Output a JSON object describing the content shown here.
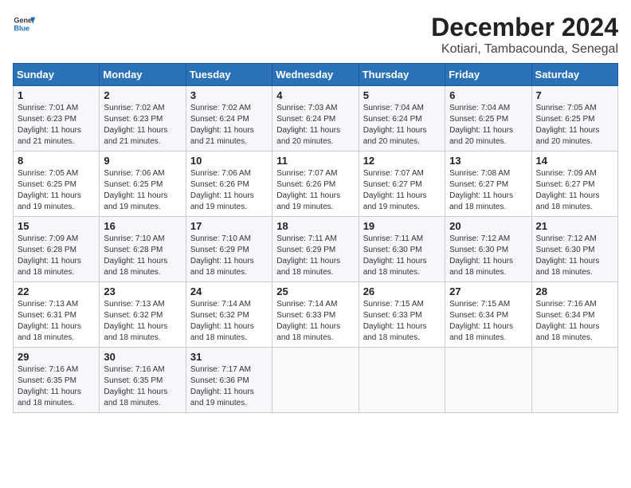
{
  "header": {
    "logo_line1": "General",
    "logo_line2": "Blue",
    "title": "December 2024",
    "subtitle": "Kotiari, Tambacounda, Senegal"
  },
  "weekdays": [
    "Sunday",
    "Monday",
    "Tuesday",
    "Wednesday",
    "Thursday",
    "Friday",
    "Saturday"
  ],
  "weeks": [
    [
      {
        "day": "1",
        "info": "Sunrise: 7:01 AM\nSunset: 6:23 PM\nDaylight: 11 hours\nand 21 minutes."
      },
      {
        "day": "2",
        "info": "Sunrise: 7:02 AM\nSunset: 6:23 PM\nDaylight: 11 hours\nand 21 minutes."
      },
      {
        "day": "3",
        "info": "Sunrise: 7:02 AM\nSunset: 6:24 PM\nDaylight: 11 hours\nand 21 minutes."
      },
      {
        "day": "4",
        "info": "Sunrise: 7:03 AM\nSunset: 6:24 PM\nDaylight: 11 hours\nand 20 minutes."
      },
      {
        "day": "5",
        "info": "Sunrise: 7:04 AM\nSunset: 6:24 PM\nDaylight: 11 hours\nand 20 minutes."
      },
      {
        "day": "6",
        "info": "Sunrise: 7:04 AM\nSunset: 6:25 PM\nDaylight: 11 hours\nand 20 minutes."
      },
      {
        "day": "7",
        "info": "Sunrise: 7:05 AM\nSunset: 6:25 PM\nDaylight: 11 hours\nand 20 minutes."
      }
    ],
    [
      {
        "day": "8",
        "info": "Sunrise: 7:05 AM\nSunset: 6:25 PM\nDaylight: 11 hours\nand 19 minutes."
      },
      {
        "day": "9",
        "info": "Sunrise: 7:06 AM\nSunset: 6:25 PM\nDaylight: 11 hours\nand 19 minutes."
      },
      {
        "day": "10",
        "info": "Sunrise: 7:06 AM\nSunset: 6:26 PM\nDaylight: 11 hours\nand 19 minutes."
      },
      {
        "day": "11",
        "info": "Sunrise: 7:07 AM\nSunset: 6:26 PM\nDaylight: 11 hours\nand 19 minutes."
      },
      {
        "day": "12",
        "info": "Sunrise: 7:07 AM\nSunset: 6:27 PM\nDaylight: 11 hours\nand 19 minutes."
      },
      {
        "day": "13",
        "info": "Sunrise: 7:08 AM\nSunset: 6:27 PM\nDaylight: 11 hours\nand 18 minutes."
      },
      {
        "day": "14",
        "info": "Sunrise: 7:09 AM\nSunset: 6:27 PM\nDaylight: 11 hours\nand 18 minutes."
      }
    ],
    [
      {
        "day": "15",
        "info": "Sunrise: 7:09 AM\nSunset: 6:28 PM\nDaylight: 11 hours\nand 18 minutes."
      },
      {
        "day": "16",
        "info": "Sunrise: 7:10 AM\nSunset: 6:28 PM\nDaylight: 11 hours\nand 18 minutes."
      },
      {
        "day": "17",
        "info": "Sunrise: 7:10 AM\nSunset: 6:29 PM\nDaylight: 11 hours\nand 18 minutes."
      },
      {
        "day": "18",
        "info": "Sunrise: 7:11 AM\nSunset: 6:29 PM\nDaylight: 11 hours\nand 18 minutes."
      },
      {
        "day": "19",
        "info": "Sunrise: 7:11 AM\nSunset: 6:30 PM\nDaylight: 11 hours\nand 18 minutes."
      },
      {
        "day": "20",
        "info": "Sunrise: 7:12 AM\nSunset: 6:30 PM\nDaylight: 11 hours\nand 18 minutes."
      },
      {
        "day": "21",
        "info": "Sunrise: 7:12 AM\nSunset: 6:30 PM\nDaylight: 11 hours\nand 18 minutes."
      }
    ],
    [
      {
        "day": "22",
        "info": "Sunrise: 7:13 AM\nSunset: 6:31 PM\nDaylight: 11 hours\nand 18 minutes."
      },
      {
        "day": "23",
        "info": "Sunrise: 7:13 AM\nSunset: 6:32 PM\nDaylight: 11 hours\nand 18 minutes."
      },
      {
        "day": "24",
        "info": "Sunrise: 7:14 AM\nSunset: 6:32 PM\nDaylight: 11 hours\nand 18 minutes."
      },
      {
        "day": "25",
        "info": "Sunrise: 7:14 AM\nSunset: 6:33 PM\nDaylight: 11 hours\nand 18 minutes."
      },
      {
        "day": "26",
        "info": "Sunrise: 7:15 AM\nSunset: 6:33 PM\nDaylight: 11 hours\nand 18 minutes."
      },
      {
        "day": "27",
        "info": "Sunrise: 7:15 AM\nSunset: 6:34 PM\nDaylight: 11 hours\nand 18 minutes."
      },
      {
        "day": "28",
        "info": "Sunrise: 7:16 AM\nSunset: 6:34 PM\nDaylight: 11 hours\nand 18 minutes."
      }
    ],
    [
      {
        "day": "29",
        "info": "Sunrise: 7:16 AM\nSunset: 6:35 PM\nDaylight: 11 hours\nand 18 minutes."
      },
      {
        "day": "30",
        "info": "Sunrise: 7:16 AM\nSunset: 6:35 PM\nDaylight: 11 hours\nand 18 minutes."
      },
      {
        "day": "31",
        "info": "Sunrise: 7:17 AM\nSunset: 6:36 PM\nDaylight: 11 hours\nand 19 minutes."
      },
      null,
      null,
      null,
      null
    ]
  ]
}
